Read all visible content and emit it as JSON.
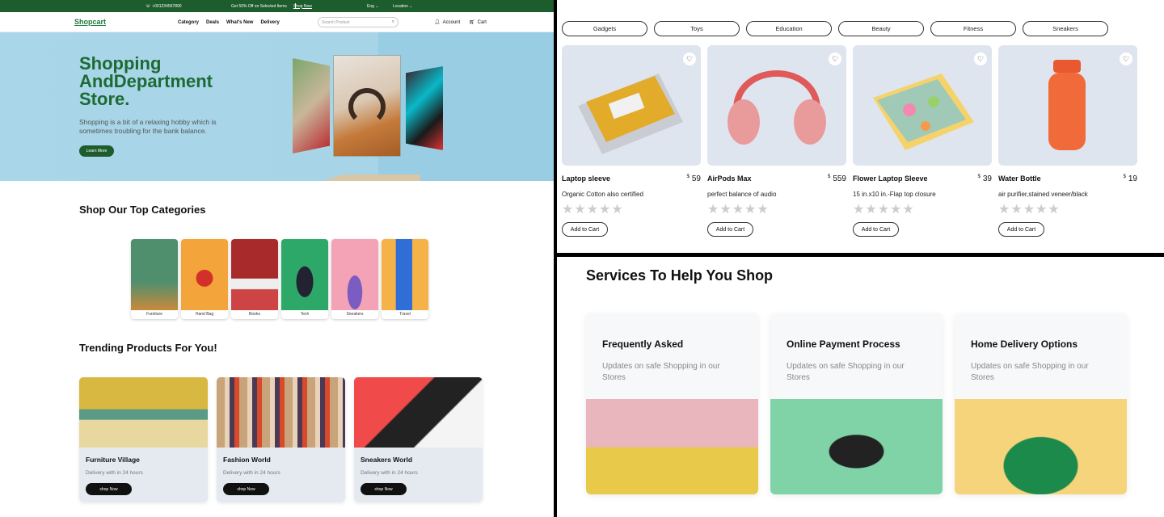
{
  "topbar": {
    "phone": "+001234567890",
    "promo": "Get 50% Off on Selected Items",
    "shop_now": "Shop Now",
    "language": "Eng",
    "location": "Location"
  },
  "navbar": {
    "logo": "Shopcart",
    "links": [
      "Category",
      "Deals",
      "What's New",
      "Delivery"
    ],
    "search_placeholder": "Search Product",
    "account": "Account",
    "cart": "Cart"
  },
  "hero": {
    "title": "Shopping AndDepartment Store.",
    "subtitle": "Shopping is a bit of a relaxing hobby which is sometimes troubling for the bank balance.",
    "button": "Learn More"
  },
  "categories": {
    "title": "Shop Our Top Categories",
    "items": [
      {
        "label": "Furniture",
        "color": "#4f8f6e"
      },
      {
        "label": "Hand Bag",
        "color": "#f3a43a"
      },
      {
        "label": "Books",
        "color": "#a82a2a"
      },
      {
        "label": "Tech",
        "color": "#2ea868"
      },
      {
        "label": "Sneakers",
        "color": "#f3a3b5"
      },
      {
        "label": "Travel",
        "color": "#f5b248"
      }
    ]
  },
  "trending": {
    "title": "Trending Products For You!",
    "items": [
      {
        "title": "Furniture Village",
        "subtitle": "Delivery with in 24 hours",
        "button": "shop Now"
      },
      {
        "title": "Fashion World",
        "subtitle": "Delivery with in 24 hours",
        "button": "shop Now"
      },
      {
        "title": "Sneakers World",
        "subtitle": "Delivery with in 24 hours",
        "button": "shop Now"
      }
    ]
  },
  "filters": [
    "Gadgets",
    "Toys",
    "Education",
    "Beauty",
    "Fitness",
    "Sneakers"
  ],
  "products": [
    {
      "name": "Laptop sleeve",
      "currency": "$",
      "price": "59",
      "desc": "Organic Cotton also certified",
      "button": "Add to Cart"
    },
    {
      "name": "AirPods Max",
      "currency": "$",
      "price": "559",
      "desc": "perfect balance of audio",
      "button": "Add to Cart"
    },
    {
      "name": "Flower Laptop Sleeve",
      "currency": "$",
      "price": "39",
      "desc": "15 in.x10 in.-Flap top closure",
      "button": "Add to Cart"
    },
    {
      "name": "Water Bottle",
      "currency": "$",
      "price": "19",
      "desc": "air purifier,stained veneer/black",
      "button": "Add to Cart"
    }
  ],
  "rating_stars": "★★★★★",
  "services": {
    "title": "Services To Help You Shop",
    "items": [
      {
        "title": "Frequently Asked",
        "desc": "Updates on safe Shopping in our Stores"
      },
      {
        "title": "Online Payment Process",
        "desc": "Updates on safe Shopping in our Stores"
      },
      {
        "title": "Home Delivery Options",
        "desc": "Updates on safe Shopping in our Stores"
      }
    ]
  }
}
